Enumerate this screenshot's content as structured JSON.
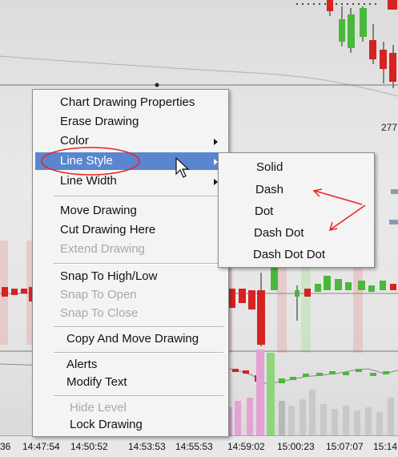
{
  "colors": {
    "menu_highlight": "#5a86d0",
    "annotation_red": "#e8231f",
    "candle_up": "#49b83c",
    "candle_down": "#d52222",
    "volume_pink": "#e4a2d4",
    "volume_green": "#8fd67a"
  },
  "chart": {
    "price_label": "277",
    "time_labels": [
      "36",
      "14:47:54",
      "14:50:52",
      "14:53:53",
      "14:55:53",
      "14:59:02",
      "15:00:23",
      "15:07:07",
      "15:14"
    ]
  },
  "context_menu": {
    "items": [
      {
        "label": "Chart Drawing Properties",
        "enabled": true
      },
      {
        "label": "Erase Drawing",
        "enabled": true
      },
      {
        "label": "Color",
        "enabled": true,
        "submenu": true
      },
      {
        "label": "Line Style",
        "enabled": true,
        "submenu": true,
        "highlighted": true
      },
      {
        "label": "Line Width",
        "enabled": true,
        "submenu": true
      },
      {
        "label": "Move Drawing",
        "enabled": true
      },
      {
        "label": "Cut Drawing Here",
        "enabled": true
      },
      {
        "label": "Extend Drawing",
        "enabled": false
      },
      {
        "label": "Snap To High/Low",
        "enabled": true
      },
      {
        "label": "Snap To Open",
        "enabled": false
      },
      {
        "label": "Snap To Close",
        "enabled": false
      },
      {
        "label": "Copy And Move Drawing",
        "enabled": true
      },
      {
        "label": "Alerts",
        "enabled": true
      },
      {
        "label": "Modify Text",
        "enabled": true
      },
      {
        "label": "Hide Level",
        "enabled": false
      },
      {
        "label": "Lock Drawing",
        "enabled": true
      }
    ]
  },
  "line_style_submenu": {
    "items": [
      "Solid",
      "Dash",
      "Dot",
      "Dash Dot",
      "Dash Dot Dot"
    ]
  },
  "icons": {
    "submenu_arrow": "chevron-right-icon",
    "cursor": "mouse-pointer-icon"
  }
}
